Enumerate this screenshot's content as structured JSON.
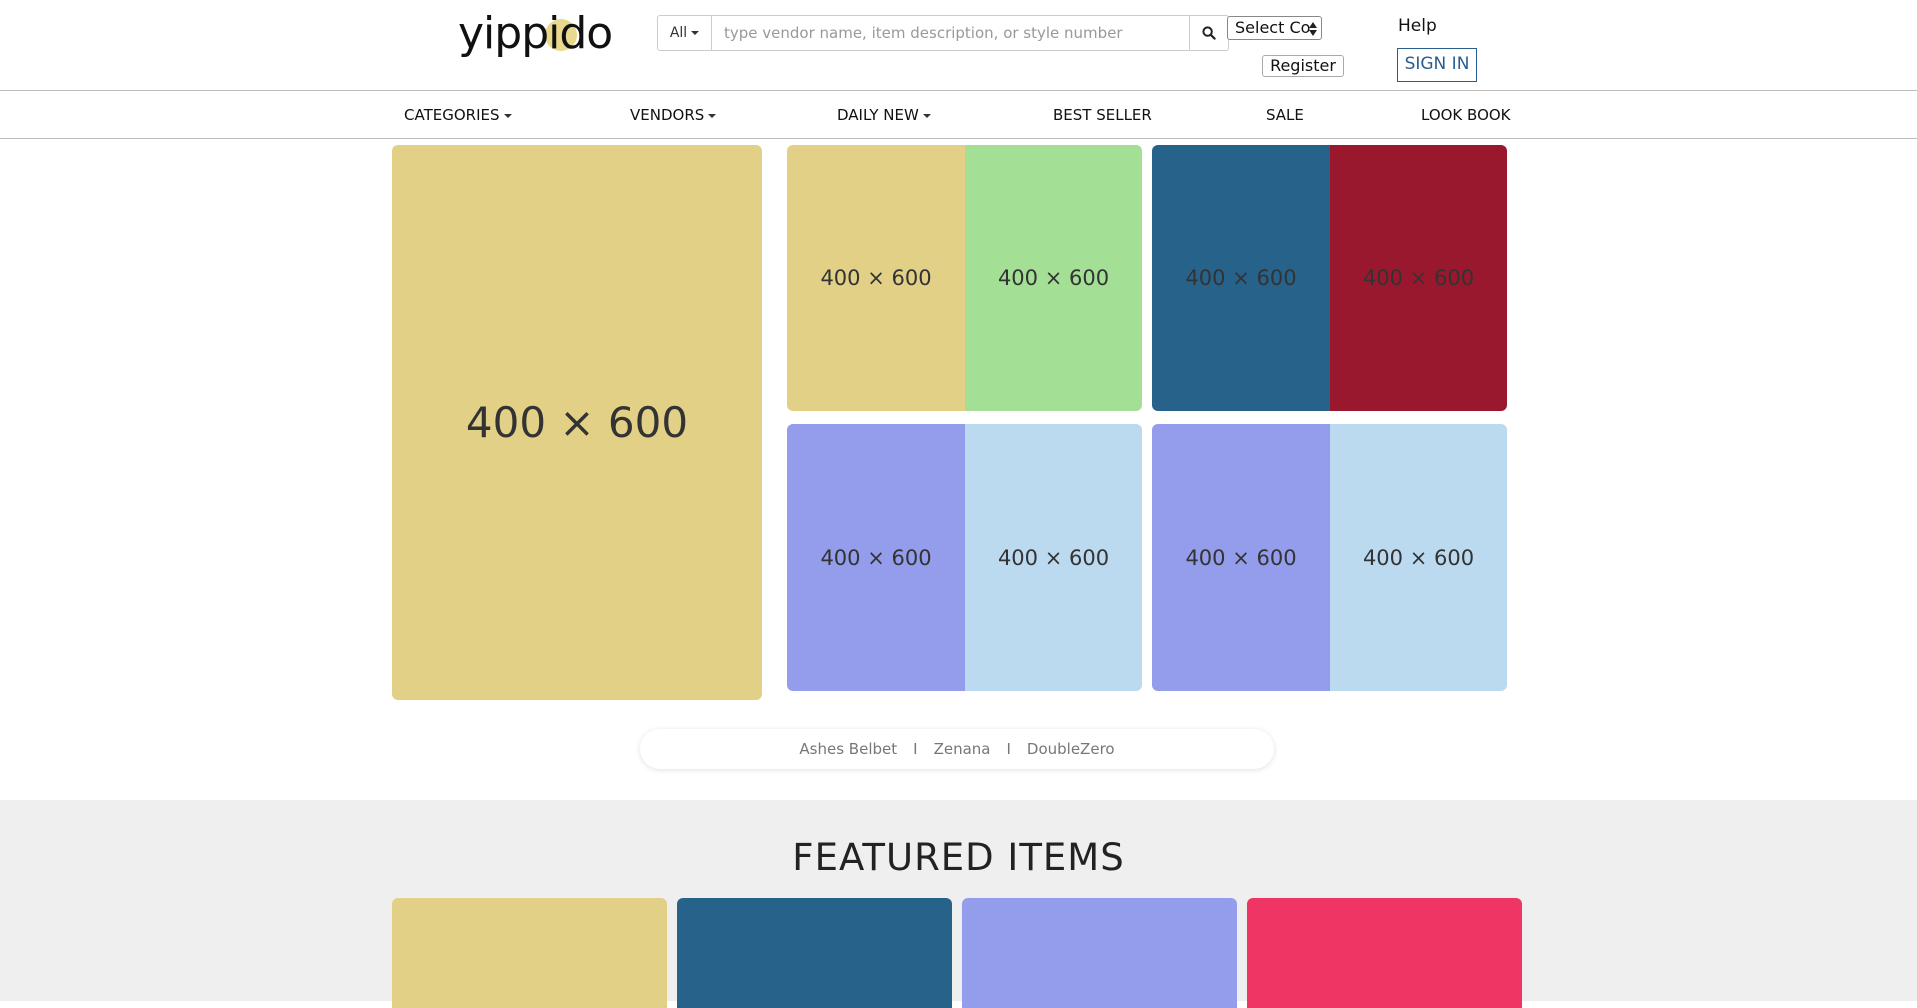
{
  "header": {
    "logo_text": "yippido",
    "search": {
      "scope_label": "All",
      "placeholder": "type vendor name, item description, or style number",
      "value": ""
    },
    "country_select_label": "Select Co",
    "help_label": "Help",
    "register_label": "Register",
    "signin_label": "SIGN IN"
  },
  "nav": {
    "items": [
      {
        "label": "CATEGORIES",
        "dropdown": true
      },
      {
        "label": "VENDORS",
        "dropdown": true
      },
      {
        "label": "DAILY NEW",
        "dropdown": true
      },
      {
        "label": "BEST SELLER",
        "dropdown": false
      },
      {
        "label": "SALE",
        "dropdown": false
      },
      {
        "label": "LOOK BOOK",
        "dropdown": false
      }
    ]
  },
  "banner": {
    "main_label": "400 × 600",
    "tiles": [
      {
        "label": "400 × 600",
        "color": "#e2d087"
      },
      {
        "label": "400 × 600",
        "color": "#a3e095"
      },
      {
        "label": "400 × 600",
        "color": "#27628b"
      },
      {
        "label": "400 × 600",
        "color": "#9a182e"
      },
      {
        "label": "400 × 600",
        "color": "#939dec"
      },
      {
        "label": "400 × 600",
        "color": "#bbdaf0"
      },
      {
        "label": "400 × 600",
        "color": "#939dec"
      },
      {
        "label": "400 × 600",
        "color": "#bbdaf0"
      }
    ],
    "main_color": "#e2d087"
  },
  "vendors": [
    "Ashes Belbet",
    "Zenana",
    "DoubleZero"
  ],
  "vendor_separator": "I",
  "featured": {
    "title": "FEATURED ITEMS",
    "card_colors": [
      "#e2d087",
      "#27628b",
      "#939dec",
      "#ee3564"
    ]
  },
  "colors": {
    "accent": "#2a5d8f",
    "featured_bg": "#efefef"
  }
}
